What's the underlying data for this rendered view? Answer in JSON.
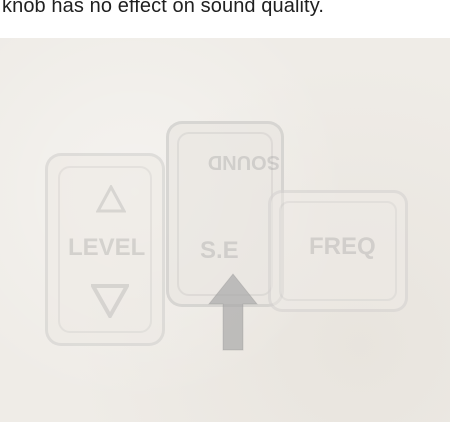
{
  "header": {
    "text": "knob has no effect on sound quality."
  },
  "diagram": {
    "faint_caption": "",
    "buttons": {
      "level": "LEVEL",
      "sound": "SOUND",
      "se": "S.E",
      "freq": "FREQ"
    },
    "icons": {
      "level_up": "triangle-up-icon",
      "level_down": "triangle-down-icon",
      "pointer": "arrow-up-icon"
    }
  }
}
